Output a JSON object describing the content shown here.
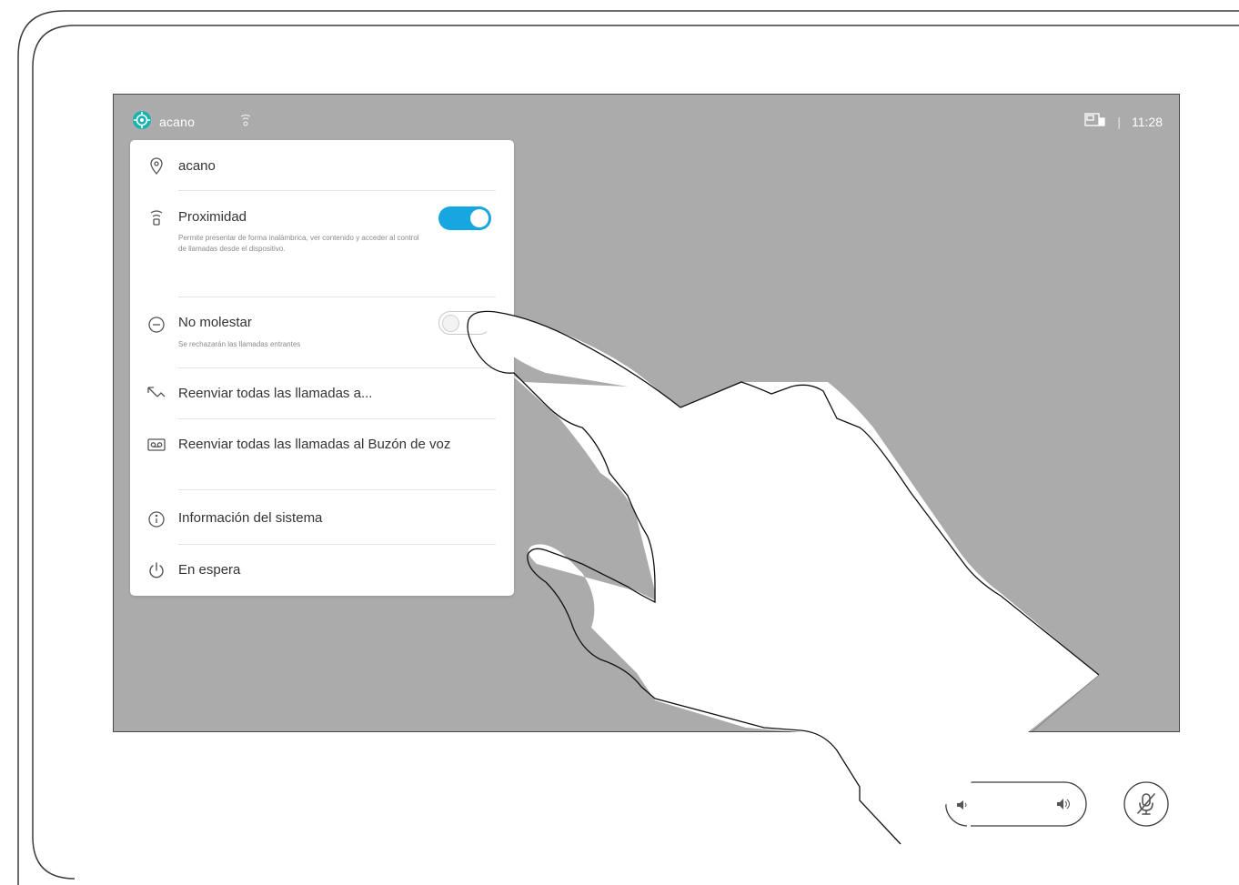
{
  "topbar": {
    "system_name": "acano",
    "time": "11:28",
    "separator": "|"
  },
  "menu": {
    "items": [
      {
        "label": "acano",
        "icon": "location-pin-icon"
      },
      {
        "label": "Proximidad",
        "icon": "proximity-icon",
        "description": "Permite presentar de forma inalámbrica, ver contenido y acceder al control de llamadas desde el dispositivo.",
        "toggle": true
      },
      {
        "label": "No molestar",
        "icon": "do-not-disturb-icon",
        "description": "Se rechazarán las llamadas entrantes",
        "toggle": false
      },
      {
        "label": "Reenviar todas las llamadas a...",
        "icon": "call-forward-icon"
      },
      {
        "label": "Reenviar todas las llamadas al Buzón de voz",
        "icon": "voicemail-icon"
      },
      {
        "label": "Información del sistema",
        "icon": "info-icon"
      },
      {
        "label": "En espera",
        "icon": "power-icon"
      }
    ]
  },
  "controls": {
    "volume": {
      "icons": [
        "volume-down-icon",
        "volume-up-icon"
      ]
    },
    "mute": {
      "icon": "microphone-muted-icon"
    }
  },
  "colors": {
    "screen_background": "#ababab",
    "toggle_on": "#16a7e1",
    "panel_background": "#ffffff"
  }
}
